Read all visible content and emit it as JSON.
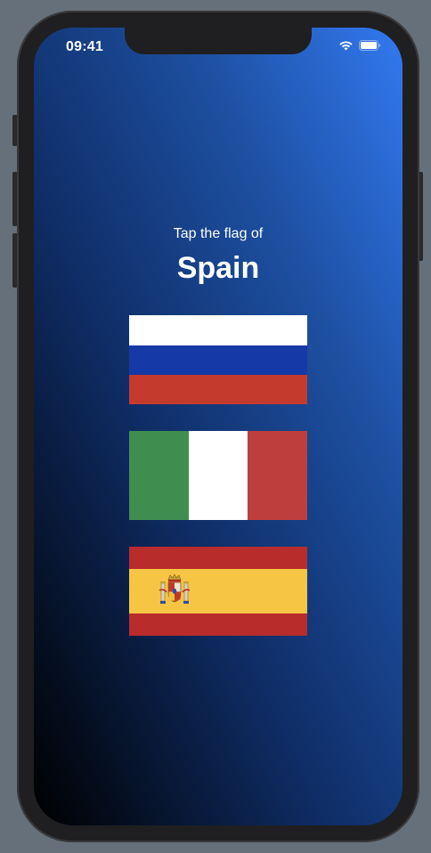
{
  "status_bar": {
    "time": "09:41",
    "wifi_icon": "wifi-icon",
    "battery_icon": "battery-icon"
  },
  "game": {
    "prompt": "Tap the flag of",
    "country": "Spain"
  },
  "flags": [
    {
      "name": "russia",
      "colors": [
        "#ffffff",
        "#1539a6",
        "#c43b2d"
      ]
    },
    {
      "name": "italy",
      "colors": [
        "#3f8e50",
        "#ffffff",
        "#be3e3e"
      ]
    },
    {
      "name": "spain",
      "colors": [
        "#b82c2c",
        "#f6c543",
        "#b82c2c"
      ],
      "emblem": "coat-of-arms-icon"
    }
  ]
}
